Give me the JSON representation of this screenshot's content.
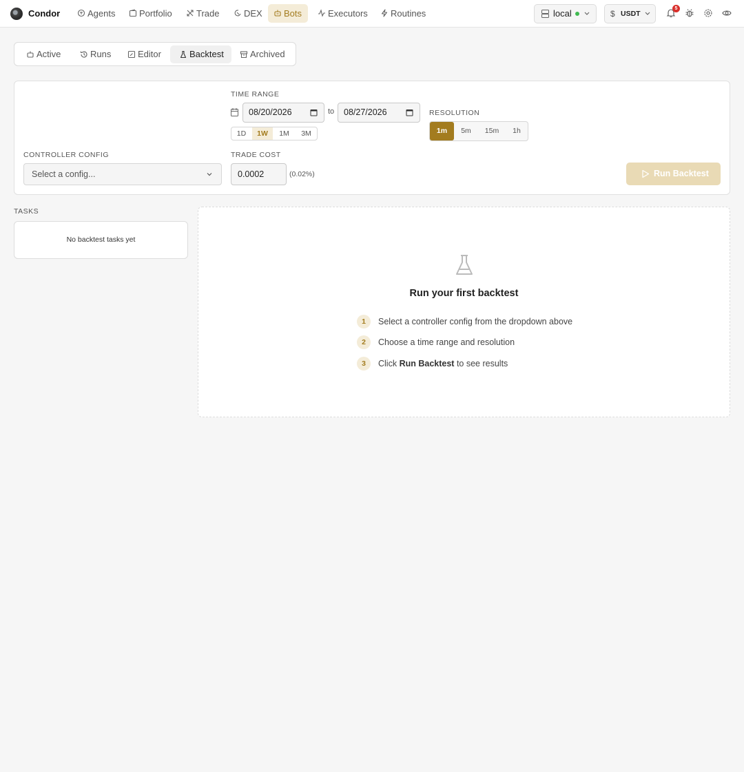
{
  "app": {
    "brand": "Condor"
  },
  "nav": {
    "items": [
      {
        "label": "Agents",
        "icon": "agents-icon"
      },
      {
        "label": "Portfolio",
        "icon": "portfolio-icon"
      },
      {
        "label": "Trade",
        "icon": "trade-icon"
      },
      {
        "label": "DEX",
        "icon": "dex-icon"
      },
      {
        "label": "Bots",
        "icon": "bots-icon",
        "active": true
      },
      {
        "label": "Executors",
        "icon": "executors-icon"
      },
      {
        "label": "Routines",
        "icon": "routines-icon"
      }
    ],
    "server_label": "local",
    "server_status_color": "#3fb950",
    "currency_label": "USDT",
    "notification_count": "5"
  },
  "tabs": [
    {
      "label": "Active",
      "icon": "bot-icon"
    },
    {
      "label": "Runs",
      "icon": "history-icon"
    },
    {
      "label": "Editor",
      "icon": "editor-icon"
    },
    {
      "label": "Backtest",
      "icon": "flask-icon",
      "active": true
    },
    {
      "label": "Archived",
      "icon": "archive-icon"
    }
  ],
  "config": {
    "time_range_label": "TIME RANGE",
    "start_date": "08/20/2026",
    "end_date": "08/27/2026",
    "to_label": "to",
    "presets": [
      "1D",
      "1W",
      "1M",
      "3M"
    ],
    "preset_selected": "1W",
    "resolution_label": "RESOLUTION",
    "resolutions": [
      "1m",
      "5m",
      "15m",
      "1h"
    ],
    "resolution_selected": "1m",
    "controller_config_label": "CONTROLLER CONFIG",
    "controller_config_placeholder": "Select a config...",
    "trade_cost_label": "TRADE COST",
    "trade_cost_value": "0.0002",
    "trade_cost_percent": "(0.02%)",
    "run_button_label": "Run Backtest"
  },
  "tasks": {
    "label": "TASKS",
    "empty_text": "No backtest tasks yet"
  },
  "empty_state": {
    "title": "Run your first backtest",
    "steps": [
      {
        "num": "1",
        "text": "Select a controller config from the dropdown above"
      },
      {
        "num": "2",
        "text": "Choose a time range and resolution"
      },
      {
        "num": "3",
        "pre": "Click",
        "bold": "Run Backtest",
        "post": "to see results"
      }
    ]
  },
  "colors": {
    "accent": "#a37c1f",
    "accent_light": "#f4ecd8",
    "run_disabled": "#e9dab5"
  }
}
